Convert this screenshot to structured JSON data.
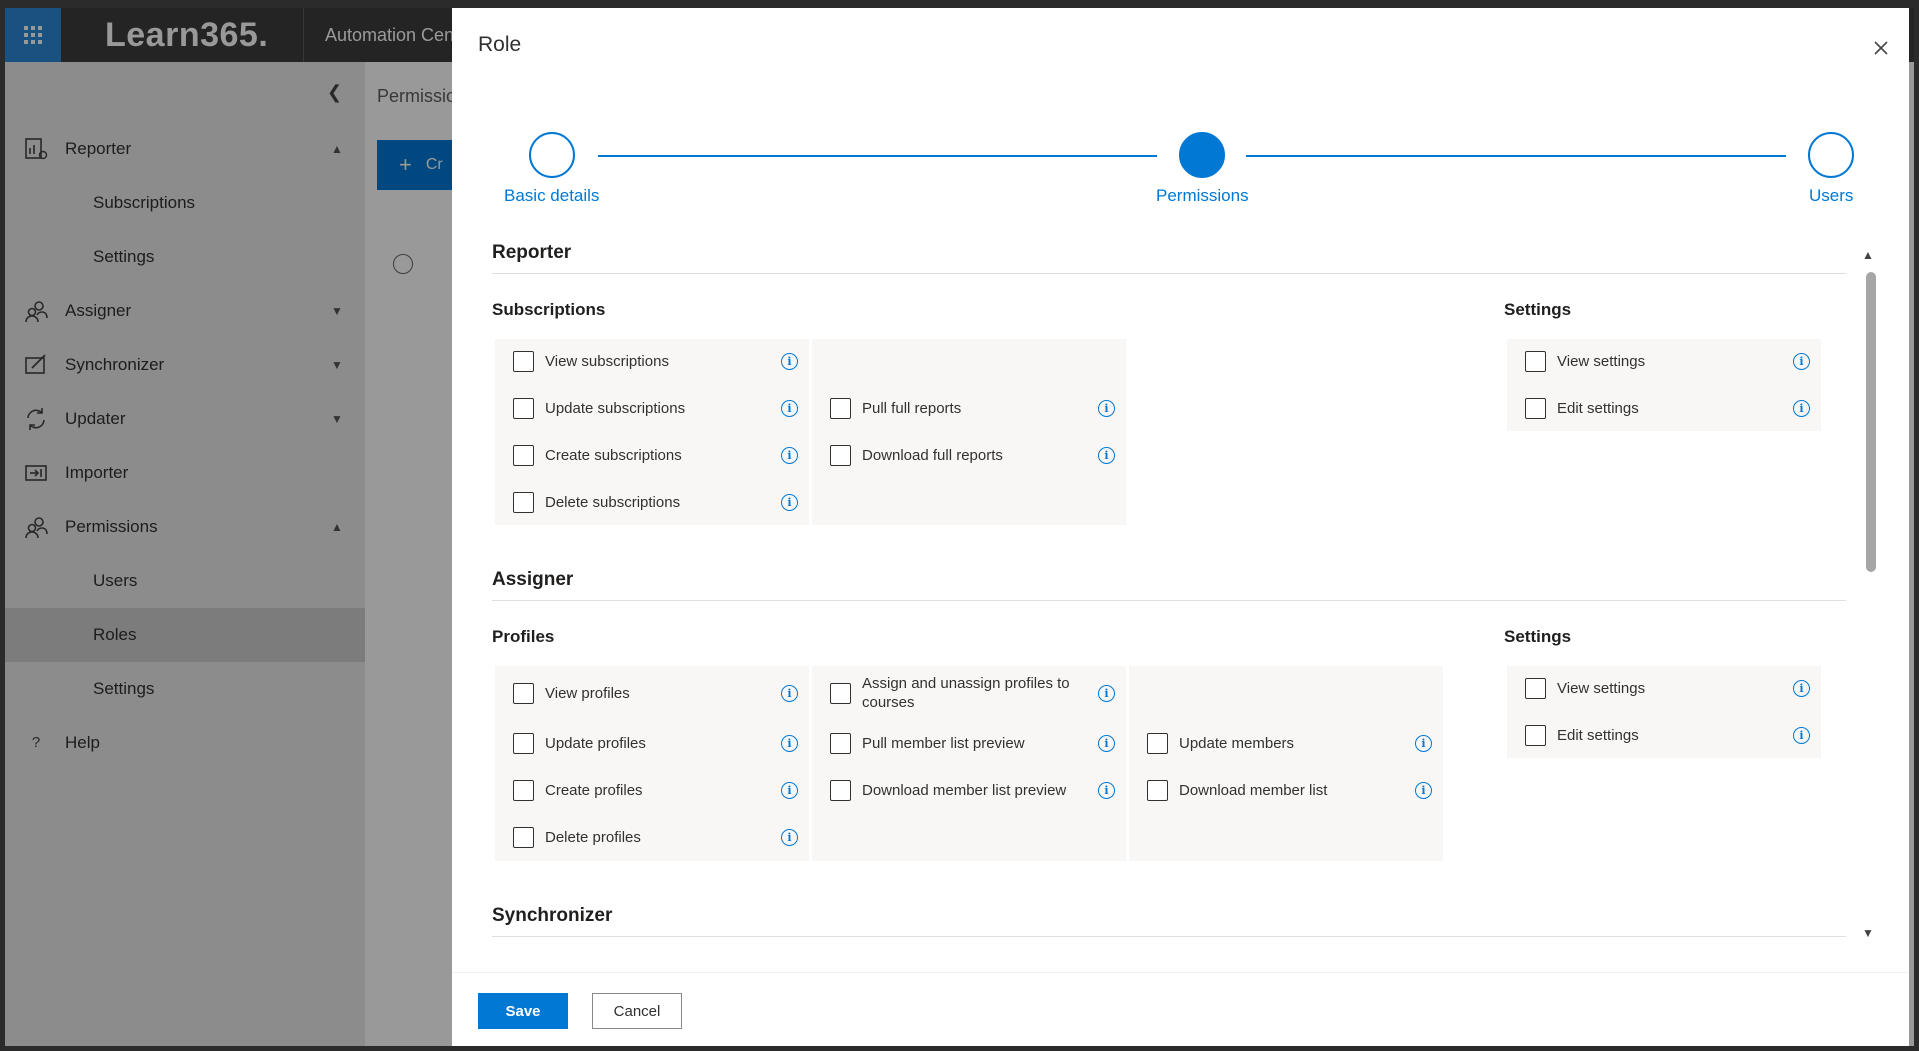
{
  "app": {
    "brand": "Learn365.",
    "app_name": "Automation Center"
  },
  "sidebar": {
    "items": [
      {
        "label": "Reporter",
        "icon": "report-icon",
        "chevron": "up"
      },
      {
        "label": "Subscriptions"
      },
      {
        "label": "Settings"
      },
      {
        "label": "Assigner",
        "icon": "people-icon",
        "chevron": "down"
      },
      {
        "label": "Synchronizer",
        "icon": "sync-edit-icon",
        "chevron": "down"
      },
      {
        "label": "Updater",
        "icon": "refresh-icon",
        "chevron": "down"
      },
      {
        "label": "Importer",
        "icon": "import-icon"
      },
      {
        "label": "Permissions",
        "icon": "people-icon",
        "chevron": "up"
      },
      {
        "label": "Users"
      },
      {
        "label": "Roles",
        "active": true
      },
      {
        "label": "Settings"
      },
      {
        "label": "Help",
        "icon": "help-icon"
      }
    ]
  },
  "content": {
    "breadcrumb": "Permissions",
    "create_label": "Cr"
  },
  "modal": {
    "title": "Role",
    "steps": [
      "Basic details",
      "Permissions",
      "Users"
    ],
    "current_step": 2,
    "sections": [
      {
        "title": "Reporter",
        "groups": [
          {
            "title": "Subscriptions",
            "col1": [
              "View subscriptions",
              "Update subscriptions",
              "Create subscriptions",
              "Delete subscriptions"
            ],
            "col2": [
              "",
              "Pull full reports",
              "Download full reports",
              ""
            ]
          },
          {
            "title": "Settings",
            "col1": [
              "View settings",
              "Edit settings"
            ]
          }
        ]
      },
      {
        "title": "Assigner",
        "groups": [
          {
            "title": "Profiles",
            "col1": [
              "View profiles",
              "Update profiles",
              "Create profiles",
              "Delete profiles"
            ],
            "col2": [
              "Assign and unassign profiles to courses",
              "Pull member list preview",
              "Download member list preview",
              ""
            ],
            "col3": [
              "",
              "Update members",
              "Download member list",
              ""
            ]
          },
          {
            "title": "Settings",
            "col1": [
              "View settings",
              "Edit settings"
            ]
          }
        ]
      },
      {
        "title": "Synchronizer"
      }
    ],
    "save_label": "Save",
    "cancel_label": "Cancel"
  },
  "colors": {
    "accent": "#0078d4",
    "waffle": "#2b88d8",
    "topbar": "#3d3d3d"
  }
}
